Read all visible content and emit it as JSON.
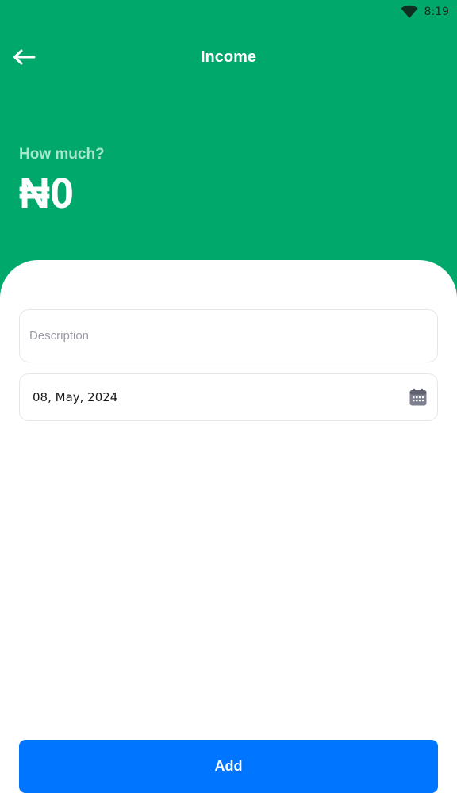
{
  "status_bar": {
    "time": "8:19",
    "icons": [
      "wifi-icon"
    ]
  },
  "header": {
    "title": "Income",
    "back_icon": "arrow-left-icon",
    "prompt": "How much?",
    "amount": "₦0",
    "background_color": "#00A86B"
  },
  "form": {
    "description": {
      "placeholder": "Description",
      "value": ""
    },
    "date": {
      "value": "08, May, 2024",
      "icon": "calendar-icon"
    }
  },
  "actions": {
    "add_label": "Add",
    "add_color": "#0075FF"
  }
}
